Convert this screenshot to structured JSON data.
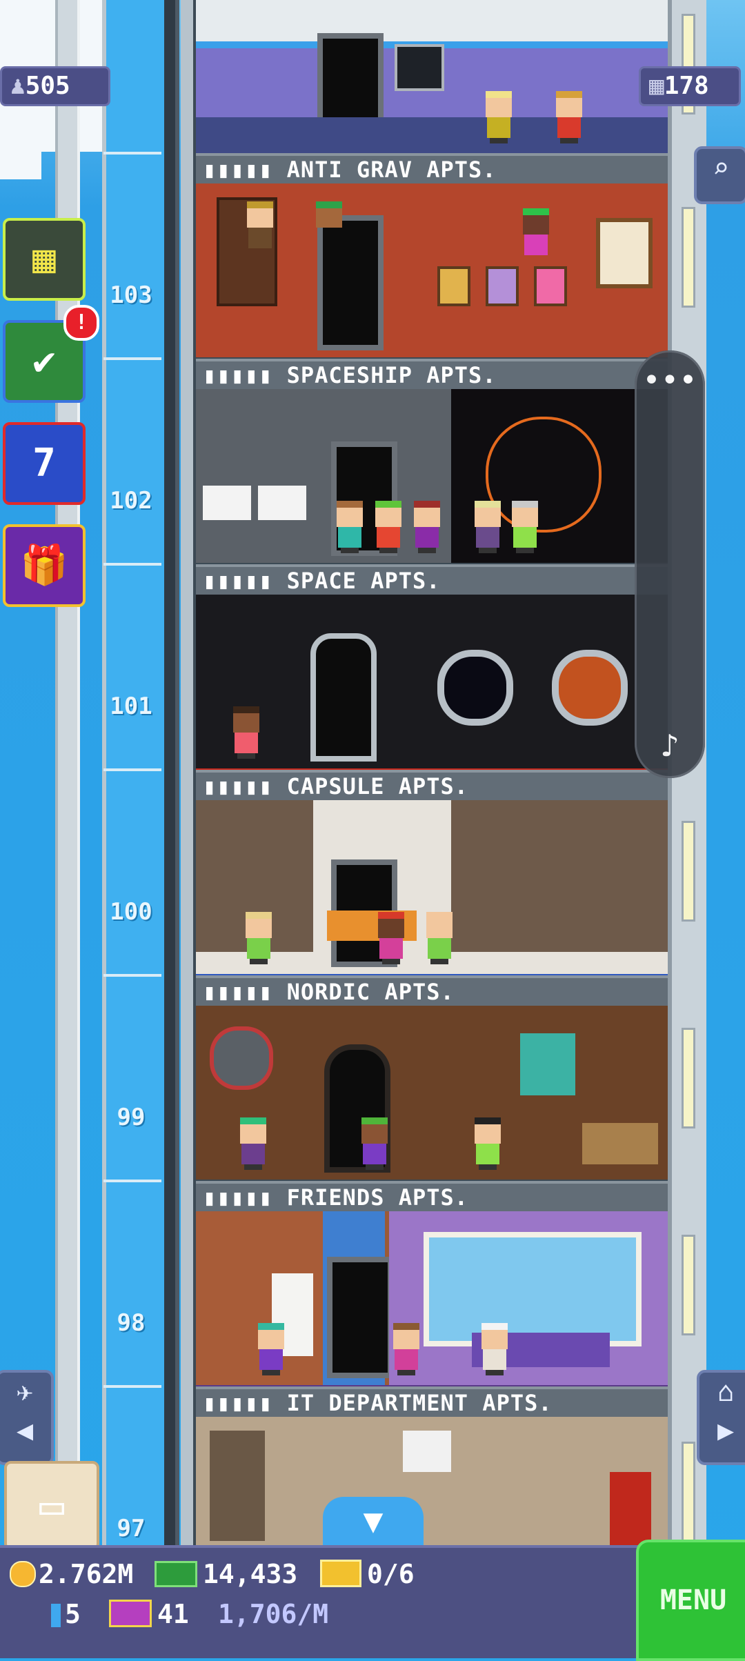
{
  "hud": {
    "population": "505",
    "floors": "178"
  },
  "floor_numbers": [
    "103",
    "102",
    "101",
    "100",
    "99",
    "98",
    "97"
  ],
  "floors": [
    {
      "name": "ANTI GRAV APTS.",
      "stars": "▮▮▮▮▮"
    },
    {
      "name": "SPACESHIP APTS.",
      "stars": "▮▮▮▮▮"
    },
    {
      "name": "SPACE APTS.",
      "stars": "▮▮▮▮▮"
    },
    {
      "name": "CAPSULE APTS.",
      "stars": "▮▮▮▮▮"
    },
    {
      "name": "NORDIC APTS.",
      "stars": "▮▮▮▮▮"
    },
    {
      "name": "FRIENDS APTS.",
      "stars": "▮▮▮▮▮"
    },
    {
      "name": "IT DEPARTMENT APTS.",
      "stars": "▮▮▮▮▮"
    }
  ],
  "side_buttons": {
    "alert_badge": "!",
    "calendar_day": "7"
  },
  "floating_panel": {
    "more": "•••",
    "music": "♪"
  },
  "bottom_bar": {
    "coins": "2.762M",
    "bux": "14,433",
    "tickets": "0/6",
    "keys": "5",
    "vip": "41",
    "rate": "1,706/M",
    "menu_label": "MENU"
  },
  "icons": [
    "person-icon",
    "building-icon",
    "search-icon",
    "tasks-icon",
    "calendar-icon",
    "gift-icon",
    "elevator-icon",
    "home-icon",
    "box-icon",
    "down-arrow-icon",
    "coin-icon",
    "bux-icon",
    "ticket-icon",
    "key-icon",
    "vip-icon",
    "music-icon"
  ],
  "colors": {
    "sky": "#2aa6ea",
    "hud_bg": "#4d5082",
    "menu_green": "#2ec236"
  }
}
